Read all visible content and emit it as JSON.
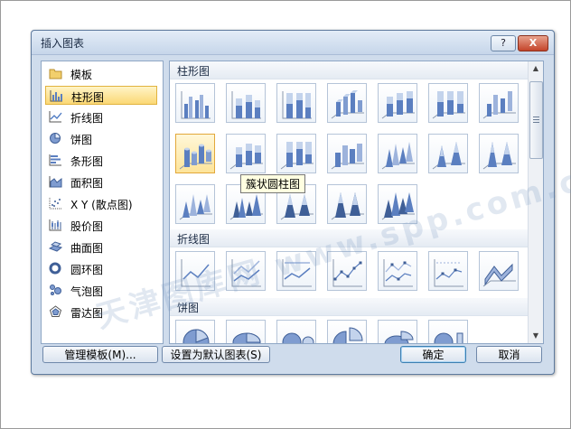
{
  "dialog": {
    "title": "插入图表",
    "help_label": "?",
    "close_label": "X"
  },
  "categories": [
    {
      "label": "模板",
      "icon": "folder-icon",
      "selected": false
    },
    {
      "label": "柱形图",
      "icon": "column-chart-icon",
      "selected": true
    },
    {
      "label": "折线图",
      "icon": "line-chart-icon",
      "selected": false
    },
    {
      "label": "饼图",
      "icon": "pie-chart-icon",
      "selected": false
    },
    {
      "label": "条形图",
      "icon": "bar-chart-icon",
      "selected": false
    },
    {
      "label": "面积图",
      "icon": "area-chart-icon",
      "selected": false
    },
    {
      "label": "X Y (散点图)",
      "icon": "scatter-chart-icon",
      "selected": false
    },
    {
      "label": "股价图",
      "icon": "stock-chart-icon",
      "selected": false
    },
    {
      "label": "曲面图",
      "icon": "surface-chart-icon",
      "selected": false
    },
    {
      "label": "圆环图",
      "icon": "doughnut-chart-icon",
      "selected": false
    },
    {
      "label": "气泡图",
      "icon": "bubble-chart-icon",
      "selected": false
    },
    {
      "label": "雷达图",
      "icon": "radar-chart-icon",
      "selected": false
    }
  ],
  "sections": {
    "column": "柱形图",
    "line": "折线图",
    "pie": "饼图"
  },
  "tooltip": "簇状圆柱图",
  "buttons": {
    "manage_templates": "管理模板(M)...",
    "set_default": "设置为默认图表(S)",
    "ok": "确定",
    "cancel": "取消"
  },
  "watermark": "天津图库网 www.spp.com.cn",
  "colors": {
    "accent": "#5b7fc0",
    "selection": "#fbd875"
  }
}
